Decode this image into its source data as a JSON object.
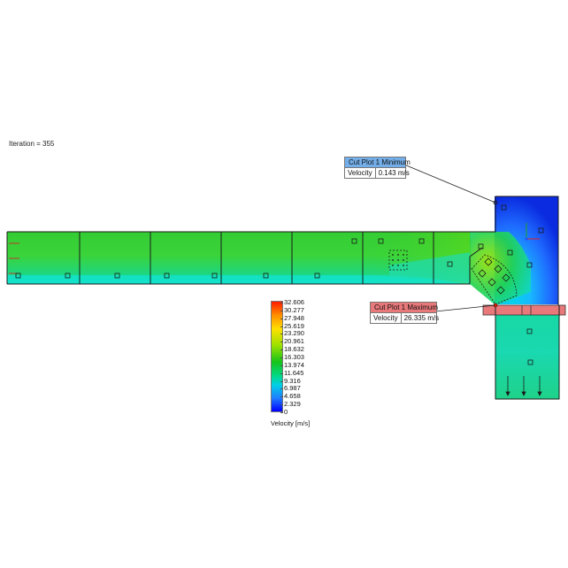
{
  "iteration_label": "Iteration = 355",
  "cut_plot_min": {
    "title": "Cut Plot 1 Minimum",
    "param": "Velocity",
    "value": "0.143 m/s"
  },
  "cut_plot_max": {
    "title": "Cut Plot 1 Maximum",
    "param": "Velocity",
    "value": "26.335 m/s"
  },
  "legend": {
    "title": "Velocity [m/s]",
    "ticks": [
      "32.606",
      "30.277",
      "27.948",
      "25.619",
      "23.290",
      "20.961",
      "18.632",
      "16.303",
      "13.974",
      "11.645",
      "9.316",
      "6.987",
      "4.658",
      "2.329",
      "0"
    ],
    "colors": [
      "#ff1a00",
      "#ff8c00",
      "#ffe000",
      "#9be000",
      "#15c41a",
      "#00d98a",
      "#00cfe6",
      "#1f7dff",
      "#0000ff"
    ]
  },
  "colors": {
    "duct_green": "#2fd02a",
    "duct_cyan": "#18e6c8",
    "duct_blue": "#1f4fff",
    "outline": "#1a1a1a",
    "flange": "#e8787a"
  }
}
